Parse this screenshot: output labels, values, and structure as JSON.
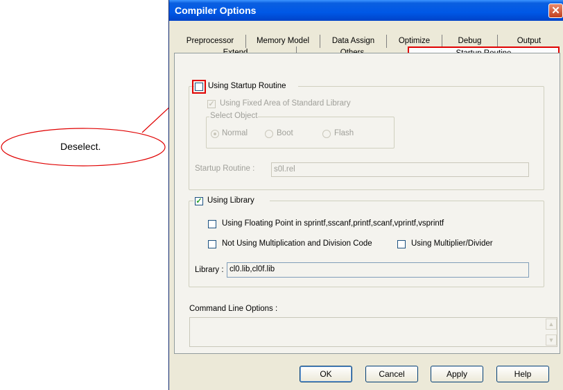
{
  "dialog": {
    "title": "Compiler Options",
    "close_icon": "close-icon",
    "tabs_row1": [
      "Preprocessor",
      "Memory Model",
      "Data Assign",
      "Optimize",
      "Debug",
      "Output"
    ],
    "tabs_row2": [
      "Extend",
      "Others",
      "Startup Routine"
    ],
    "active_tab": "Startup Routine",
    "startup_group": {
      "checkbox_label": "Using Startup Routine",
      "checked": false,
      "fixed_area_label": "Using Fixed Area of Standard Library",
      "fixed_area_checked": true,
      "select_object_label": "Select Object",
      "options": [
        "Normal",
        "Boot",
        "Flash"
      ],
      "selected_option": "Normal",
      "routine_label": "Startup Routine :",
      "routine_value": "s0l.rel"
    },
    "library_group": {
      "checkbox_label": "Using Library",
      "checked": true,
      "floating_label": "Using Floating Point in sprintf,sscanf,printf,scanf,vprintf,vsprintf",
      "mul_div_label": "Not Using Multiplication and Division Code",
      "multiplier_label": "Using Multiplier/Divider",
      "library_label": "Library :",
      "library_value": "cl0.lib,cl0f.lib"
    },
    "command_line_label": "Command Line Options :",
    "buttons": {
      "ok": "OK",
      "cancel": "Cancel",
      "apply": "Apply",
      "help": "Help"
    }
  },
  "callout": {
    "text": "Deselect."
  },
  "colors": {
    "highlight": "#e00000",
    "title_bar": "#0058e6",
    "dialog_bg": "#ece9d8"
  }
}
